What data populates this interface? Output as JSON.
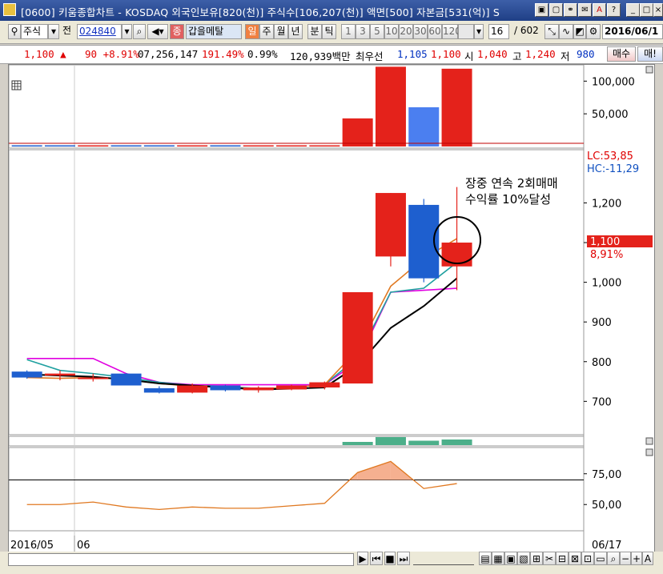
{
  "window": {
    "title": "[0600] 키움종합차트 - KOSDAQ 외국인보유[820(천)] 주식수[106,207(천)] 액면[500] 자본금[531(억)] S"
  },
  "toolbar": {
    "market": "주식",
    "prev_label": "전",
    "code": "024840",
    "tag_jong": "종",
    "stock_name": "갑을메탈",
    "period_il": "일",
    "period_ju": "주",
    "period_wol": "월",
    "period_nyeon": "년",
    "period_bun": "분",
    "period_tik": "틱",
    "intervals": [
      "1",
      "3",
      "5",
      "10",
      "20",
      "30",
      "60",
      "120"
    ],
    "count": "16",
    "total": "/ 602",
    "date": "2016/06/1"
  },
  "infobar": {
    "price": "1,100 ▲",
    "change": "90 +8.91%",
    "volume": "07,256,147",
    "vol_ratio": "191.49%",
    "turnover": "0.99%",
    "amount": "120,939백만",
    "best_label": "최우선",
    "best_ask": "1,105",
    "best_bid": "1,100",
    "open_label": "시",
    "open": "1,040",
    "high_label": "고",
    "high": "1,240",
    "low_label": "저",
    "low": "980",
    "buy_button": "매수",
    "sell_button": "매!"
  },
  "chart_data": [
    {
      "type": "bar",
      "panel": "volume",
      "ylim": [
        0,
        120000
      ],
      "ticks": [
        "100,000",
        "50,000"
      ],
      "values": [
        1200,
        1000,
        900,
        1100,
        900,
        700,
        800,
        800,
        1000,
        1200,
        43000,
        122000,
        60000,
        119000
      ],
      "colors": [
        "#1e5fcf",
        "#1e5fcf",
        "#e4221b",
        "#1e5fcf",
        "#1e5fcf",
        "#e4221b",
        "#1e5fcf",
        "#e4221b",
        "#e4221b",
        "#e4221b",
        "#e4221b",
        "#e4221b",
        "#4b7ff0",
        "#e4221b"
      ]
    },
    {
      "type": "candlestick",
      "panel": "price",
      "ylim": [
        620,
        1330
      ],
      "ticks": [
        "1,200",
        "1,100",
        "1,000",
        "900",
        "800",
        "700"
      ],
      "candles": [
        {
          "o": 775,
          "h": 778,
          "l": 757,
          "c": 760,
          "up": false
        },
        {
          "o": 765,
          "h": 778,
          "l": 753,
          "c": 770,
          "up": true
        },
        {
          "o": 760,
          "h": 770,
          "l": 750,
          "c": 758,
          "up": true
        },
        {
          "o": 770,
          "h": 771,
          "l": 740,
          "c": 740,
          "up": false
        },
        {
          "o": 733,
          "h": 738,
          "l": 720,
          "c": 722,
          "up": false
        },
        {
          "o": 722,
          "h": 745,
          "l": 720,
          "c": 740,
          "up": true
        },
        {
          "o": 740,
          "h": 742,
          "l": 725,
          "c": 728,
          "up": false
        },
        {
          "o": 728,
          "h": 738,
          "l": 722,
          "c": 735,
          "up": true
        },
        {
          "o": 730,
          "h": 742,
          "l": 728,
          "c": 740,
          "up": true
        },
        {
          "o": 735,
          "h": 750,
          "l": 730,
          "c": 748,
          "up": true
        },
        {
          "o": 745,
          "h": 975,
          "l": 745,
          "c": 975,
          "up": true
        },
        {
          "o": 1065,
          "h": 1225,
          "l": 1040,
          "c": 1225,
          "up": true
        },
        {
          "o": 1195,
          "h": 1210,
          "l": 1000,
          "c": 1010,
          "up": false
        },
        {
          "o": 1040,
          "h": 1240,
          "l": 980,
          "c": 1100,
          "up": true
        }
      ],
      "ma_series": [
        {
          "color": "#e000e0",
          "values": [
            808,
            808,
            808,
            770,
            748,
            742,
            742,
            742,
            742,
            742,
            800,
            975,
            980,
            985
          ]
        },
        {
          "color": "#20a0a0",
          "values": [
            805,
            778,
            770,
            760,
            748,
            740,
            738,
            732,
            735,
            742,
            810,
            975,
            985,
            1050
          ]
        },
        {
          "color": "#e07820",
          "values": [
            760,
            758,
            760,
            755,
            745,
            738,
            735,
            732,
            735,
            742,
            830,
            990,
            1060,
            1110
          ]
        },
        {
          "color": "#000000",
          "values": [
            768,
            765,
            762,
            755,
            745,
            740,
            735,
            730,
            732,
            735,
            790,
            885,
            940,
            1010
          ]
        }
      ],
      "lc_label": "LC:53,85",
      "hc_label": "HC:-11,29",
      "last_price": "1,100",
      "last_change": "8,91%",
      "annotation_line1": "장중 연속 2회매매",
      "annotation_line2": "수익률 10%달성"
    },
    {
      "type": "bar",
      "panel": "small-volume",
      "values": [
        1,
        1,
        0,
        0,
        0,
        0,
        0,
        0,
        0,
        0,
        40,
        100,
        55,
        70
      ]
    },
    {
      "type": "area",
      "panel": "oscillator",
      "ylim": [
        30,
        95
      ],
      "ticks": [
        "75,00",
        "50,00"
      ],
      "threshold": 70,
      "values": [
        50,
        50,
        52,
        48,
        46,
        48,
        47,
        47,
        49,
        51,
        76,
        85,
        63,
        67
      ]
    }
  ],
  "xaxis": {
    "start_label": "2016/05",
    "mid_label": "06",
    "end_label": "06/17"
  }
}
